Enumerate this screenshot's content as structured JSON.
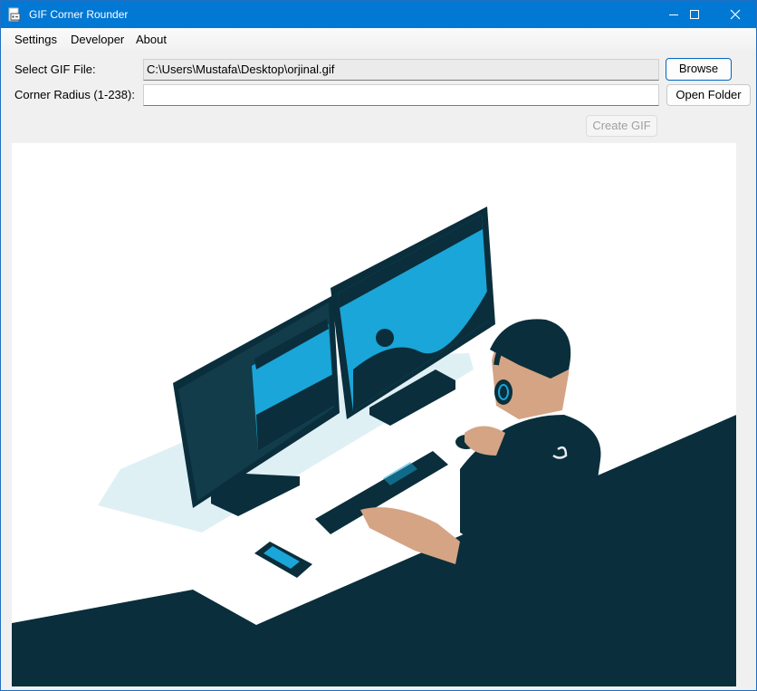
{
  "window": {
    "title": "GIF Corner Rounder",
    "accent": "#0078d4"
  },
  "menu": {
    "items": [
      "Settings",
      "Developer",
      "About"
    ]
  },
  "form": {
    "file_label": "Select GIF File:",
    "file_value": "C:\\Users\\Mustafa\\Desktop\\orjinal.gif",
    "radius_label": "Corner Radius (1-238):",
    "radius_value": "",
    "browse_label": "Browse",
    "open_folder_label": "Open Folder",
    "create_label": "Create GIF"
  },
  "preview": {
    "icons": [
      "monitor-icon",
      "headset-icon",
      "keyboard-icon",
      "mouse-icon",
      "phone-icon"
    ],
    "colors": {
      "dark": "#0a2e3b",
      "accent": "#1aa6d8",
      "skin": "#d4a484",
      "floor": "#dff0f5"
    }
  }
}
